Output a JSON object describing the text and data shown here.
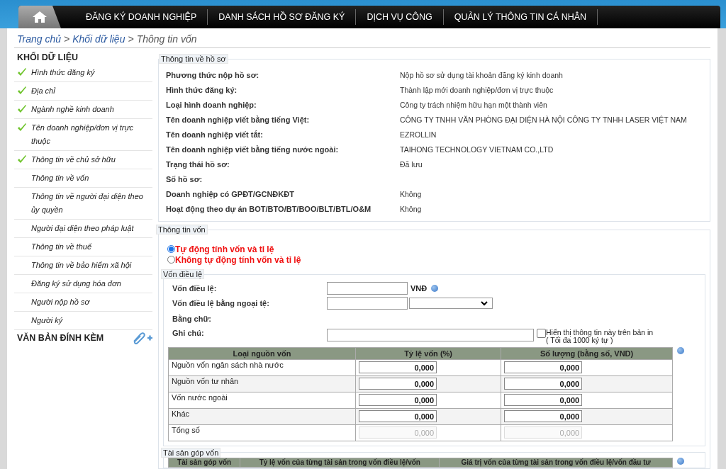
{
  "nav": {
    "items": [
      {
        "label": "ĐĂNG KÝ DOANH NGHIỆP"
      },
      {
        "label": "DANH SÁCH HỒ SƠ ĐĂNG KÝ"
      },
      {
        "label": "DỊCH VỤ CÔNG"
      },
      {
        "label": "QUẢN LÝ THÔNG TIN CÁ NHÂN"
      }
    ]
  },
  "breadcrumb": {
    "links": [
      "Trang chủ",
      "Khối dữ liệu"
    ],
    "current": "Thông tin vốn",
    "separator": ">"
  },
  "sidebar": {
    "title": "KHỐI DỮ LIỆU",
    "items": [
      {
        "label": "Hình thức đăng ký",
        "done": true
      },
      {
        "label": "Địa chỉ",
        "done": true
      },
      {
        "label": "Ngành nghề kinh doanh",
        "done": true
      },
      {
        "label": "Tên doanh nghiệp/đơn vị trực thuộc",
        "done": true
      },
      {
        "label": "Thông tin về chủ sở hữu",
        "done": true
      },
      {
        "label": "Thông tin về vốn",
        "done": false
      },
      {
        "label": "Thông tin về người đại diện theo ủy quyền",
        "done": false
      },
      {
        "label": "Người đại diện theo pháp luật",
        "done": false
      },
      {
        "label": "Thông tin về thuế",
        "done": false
      },
      {
        "label": "Thông tin về bảo hiểm xã hội",
        "done": false
      },
      {
        "label": "Đăng ký sử dụng hóa đơn",
        "done": false
      },
      {
        "label": "Người nộp hồ sơ",
        "done": false
      },
      {
        "label": "Người ký",
        "done": false
      }
    ],
    "attachments_title": "VĂN BẢN ĐÍNH KÈM"
  },
  "profile": {
    "legend": "Thông tin về hồ sơ",
    "rows": [
      {
        "label": "Phương thức nộp hồ sơ:",
        "value": "Nộp hồ sơ sử dụng tài khoản đăng ký kinh doanh"
      },
      {
        "label": "Hình thức đăng ký:",
        "value": "Thành lập mới doanh nghiệp/đơn vị trực thuộc"
      },
      {
        "label": "Loại hình doanh nghiệp:",
        "value": "Công ty trách nhiệm hữu hạn một thành viên"
      },
      {
        "label": "Tên doanh nghiệp viết bằng tiếng Việt:",
        "value": "CÔNG TY TNHH VĂN PHÒNG ĐẠI DIỆN HÀ NỘI CÔNG TY TNHH LASER VIỆT NAM"
      },
      {
        "label": "Tên doanh nghiệp viết tắt:",
        "value": "EZROLLIN"
      },
      {
        "label": "Tên doanh nghiệp viết bằng tiếng nước ngoài:",
        "value": "TAIHONG TECHNOLOGY VIETNAM CO.,LTD"
      },
      {
        "label": "Trạng thái hồ sơ:",
        "value": "Đã lưu"
      },
      {
        "label": "Số hồ sơ:"
      },
      {
        "label": "Doanh nghiệp có GPĐT/GCNĐKĐT",
        "value": "Không"
      },
      {
        "label": "Hoạt động theo dự án BOT/BTO/BT/BOO/BLT/BTL/O&M",
        "value": "Không"
      }
    ]
  },
  "capital": {
    "legend": "Thông tin vốn",
    "modes": [
      {
        "label": "Tự động tính vốn và tỉ lệ",
        "selected": true
      },
      {
        "label": "Không tự động tính vốn và tỉ lệ",
        "selected": false
      }
    ],
    "charter": {
      "legend": "Vốn điều lệ",
      "capital_label": "Vốn điều lệ:",
      "currency": "VNĐ",
      "foreign_label": "Vốn điều lệ bằng ngoại tệ:",
      "words_label": "Bằng chữ:",
      "note_label": "Ghi chú:",
      "print_label": "Hiển thị thông tin này trên bản in",
      "print_checked": false,
      "note_hint": "( Tối đa 1000 ký tự )"
    },
    "table": {
      "columns": [
        "Loại nguồn vốn",
        "Tỷ lệ vốn (%)",
        "Số lượng (bằng số, VND)"
      ],
      "rows": [
        {
          "source": "Nguồn vốn ngân sách nhà nước",
          "ratio": "0,000",
          "amount": "0,000",
          "disabled": false
        },
        {
          "source": "Nguồn vốn tư nhân",
          "ratio": "0,000",
          "amount": "0,000",
          "disabled": false
        },
        {
          "source": "Vốn nước ngoài",
          "ratio": "0,000",
          "amount": "0,000",
          "disabled": false
        },
        {
          "source": "Khác",
          "ratio": "0,000",
          "amount": "0,000",
          "disabled": false
        },
        {
          "source": "Tổng số",
          "ratio": "0,000",
          "amount": "0,000",
          "disabled": true
        }
      ]
    }
  },
  "assets": {
    "legend": "Tài sản góp vốn",
    "columns": [
      "Tài sản góp vốn",
      "Tỷ lệ vốn của từng tài sản trong vốn điều lệ/vốn",
      "Giá trị vốn của từng tài sản trong vốn điều lệ/vốn đầu tư"
    ]
  }
}
